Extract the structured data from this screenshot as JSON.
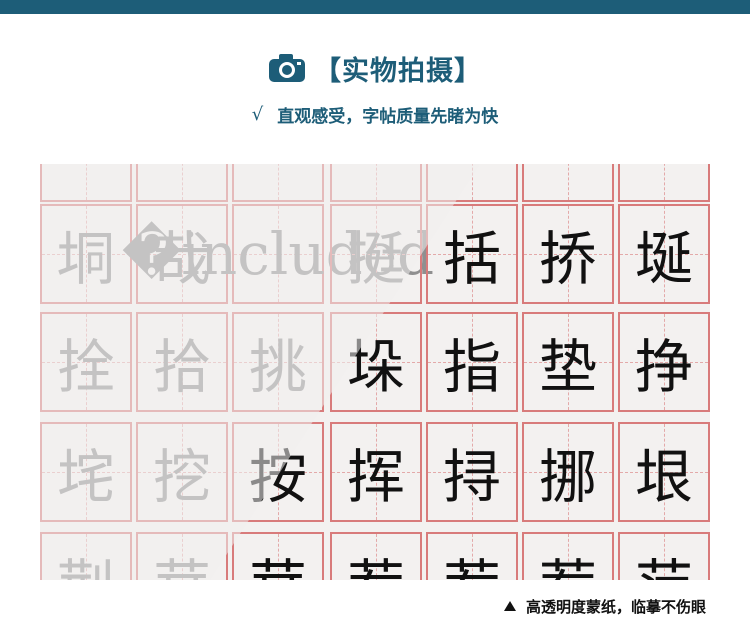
{
  "header": {
    "title_open": "【",
    "title": "实物拍摄",
    "title_close": "】",
    "check_mark": "√",
    "subtitle": "直观感受，字帖质量先睹为快",
    "camera_icon": "camera-icon",
    "accent_color": "#1d5d78"
  },
  "photo": {
    "rows": [
      {
        "chars": [
          "",
          "",
          "",
          "",
          "",
          "",
          ""
        ]
      },
      {
        "chars": [
          "垌",
          "哉",
          "�included",
          "挺",
          "括",
          "挢",
          "埏"
        ]
      },
      {
        "chars": [
          "拴",
          "拾",
          "挑",
          "垛",
          "指",
          "垫",
          "挣"
        ]
      },
      {
        "chars": [
          "垞",
          "挖",
          "按",
          "挥",
          "挦",
          "挪",
          "垠"
        ]
      },
      {
        "chars": [
          "荆",
          "茸",
          "茸",
          "茬",
          "茬",
          "荐",
          "茳"
        ]
      }
    ],
    "grid_color": "#d87b7b"
  },
  "caption": {
    "triangle_icon": "triangle-up-icon",
    "text": "高透明度蒙纸，临摹不伤眼"
  }
}
